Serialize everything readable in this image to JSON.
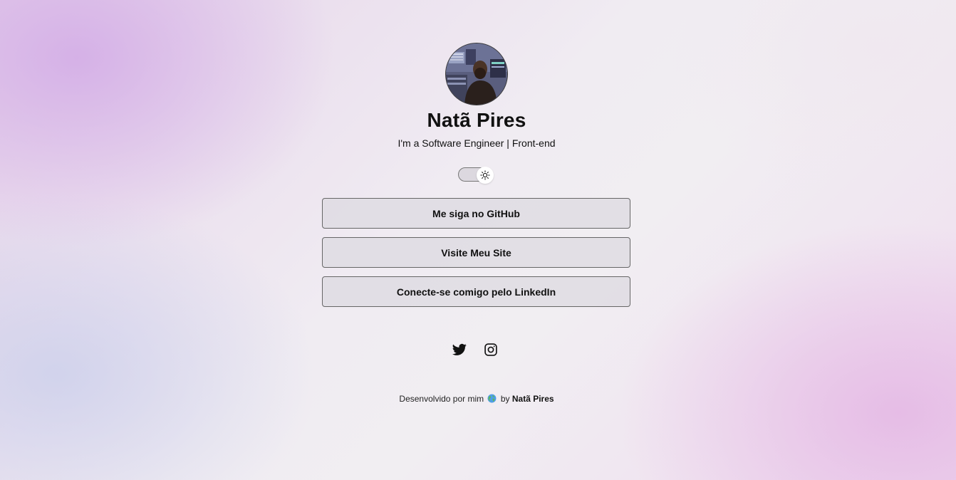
{
  "profile": {
    "avatar_icon": "avatar-photo",
    "name": "Natã Pires",
    "subtitle": "I'm a Software Engineer | Front-end"
  },
  "theme_toggle": {
    "icon": "sun-icon",
    "state": "light"
  },
  "links": [
    {
      "label": "Me siga no GitHub"
    },
    {
      "label": "Visite Meu Site"
    },
    {
      "label": "Conecte-se comigo pelo LinkedIn"
    }
  ],
  "socials": [
    {
      "icon": "twitter-icon"
    },
    {
      "icon": "instagram-icon"
    }
  ],
  "footer": {
    "text": "Desenvolvido por mim",
    "globe_icon": "globe-icon",
    "by": "by",
    "author": "Natã Pires"
  },
  "colors": {
    "text": "#111111",
    "button_border": "#666666"
  }
}
